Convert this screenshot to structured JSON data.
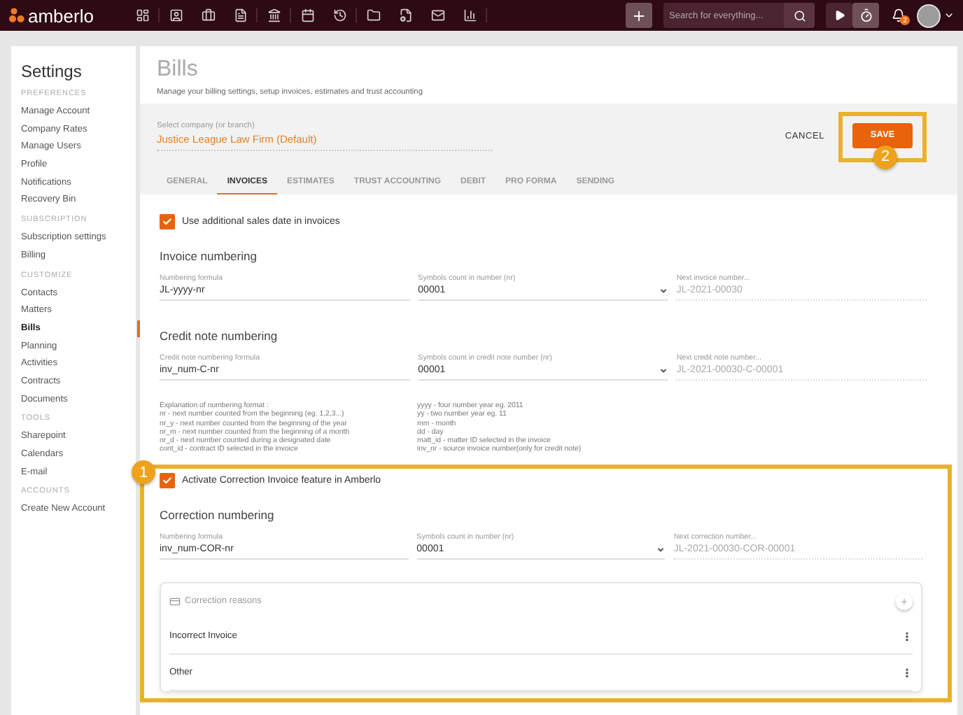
{
  "topbar": {
    "logo": "amberlo",
    "search": {
      "placeholder": "Search for everything..."
    },
    "notification_count": "2"
  },
  "sidebar": {
    "title": "Settings",
    "sections": [
      {
        "heading": "PREFERENCES",
        "items": [
          {
            "label": "Manage Account",
            "selected": false
          },
          {
            "label": "Company Rates",
            "selected": false
          },
          {
            "label": "Manage Users",
            "selected": false
          },
          {
            "label": "Profile",
            "selected": false
          },
          {
            "label": "Notifications",
            "selected": false
          },
          {
            "label": "Recovery Bin",
            "selected": false
          }
        ]
      },
      {
        "heading": "SUBSCRIPTION",
        "items": [
          {
            "label": "Subscription settings",
            "selected": false
          },
          {
            "label": "Billing",
            "selected": false
          }
        ]
      },
      {
        "heading": "CUSTOMIZE",
        "items": [
          {
            "label": "Contacts",
            "selected": false
          },
          {
            "label": "Matters",
            "selected": false
          },
          {
            "label": "Bills",
            "selected": true
          },
          {
            "label": "Planning",
            "selected": false
          },
          {
            "label": "Activities",
            "selected": false
          },
          {
            "label": "Contracts",
            "selected": false
          },
          {
            "label": "Documents",
            "selected": false
          }
        ]
      },
      {
        "heading": "TOOLS",
        "items": [
          {
            "label": "Sharepoint",
            "selected": false
          },
          {
            "label": "Calendars",
            "selected": false
          },
          {
            "label": "E-mail",
            "selected": false
          }
        ]
      },
      {
        "heading": "ACCOUNTS",
        "items": [
          {
            "label": "Create New Account",
            "selected": false
          }
        ]
      }
    ]
  },
  "page": {
    "title": "Bills",
    "subtitle": "Manage your billing settings, setup invoices, estimates and trust accounting",
    "company": {
      "label": "Select company (or branch)",
      "value": "Justice League Law Firm (Default)"
    },
    "buttons": {
      "cancel": "CANCEL",
      "save": "SAVE"
    },
    "tabs": [
      {
        "label": "GENERAL",
        "selected": false
      },
      {
        "label": "INVOICES",
        "selected": true
      },
      {
        "label": "ESTIMATES",
        "selected": false
      },
      {
        "label": "TRUST ACCOUNTING",
        "selected": false
      },
      {
        "label": "DEBIT",
        "selected": false
      },
      {
        "label": "PRO FORMA",
        "selected": false
      },
      {
        "label": "SENDING",
        "selected": false
      }
    ]
  },
  "sales_date": {
    "label": "Use additional sales date in invoices",
    "checked": true
  },
  "invoice_numbering": {
    "title": "Invoice numbering",
    "fields": [
      {
        "kind": "text",
        "label": "Numbering formula",
        "value": "JL-yyyy-nr"
      },
      {
        "kind": "select",
        "label": "Symbols count in number (nr)",
        "value": "00001"
      },
      {
        "kind": "readonly",
        "label": "Next invoice number...",
        "value": "JL-2021-00030"
      }
    ]
  },
  "credit_note_numbering": {
    "title": "Credit note numbering",
    "fields": [
      {
        "kind": "text",
        "label": "Credit note numbering formula",
        "value": "inv_num-C-nr"
      },
      {
        "kind": "select",
        "label": "Symbols count in credit note number (nr)",
        "value": "00001"
      },
      {
        "kind": "readonly",
        "label": "Next credit note number...",
        "value": "JL-2021-00030-C-00001"
      }
    ]
  },
  "explanation": {
    "left": [
      "Explanation of numbering format :",
      "nr - next number counted from the beginning (eg. 1,2,3...)",
      "nr_y - next number counted from the beginning of the year",
      "nr_m - next number counted from the beginning of a month",
      "nr_d - next number counted during a designated date",
      "cont_id - contract ID selected in the invoice"
    ],
    "right": [
      "yyyy - four number year eg. 2011",
      "yy - two number year eg. 11",
      "mm - month",
      "dd - day",
      "matt_id - matter ID selected in the invoice",
      "inv_nr - source invoice number(only for credit note)"
    ]
  },
  "correction": {
    "checkbox": {
      "label": "Activate Correction Invoice feature in Amberlo",
      "checked": true
    },
    "title": "Correction numbering",
    "fields": [
      {
        "kind": "text",
        "label": "Numbering formula",
        "value": "inv_num-COR-nr"
      },
      {
        "kind": "select",
        "label": "Symbols count in number (nr)",
        "value": "00001"
      },
      {
        "kind": "readonly",
        "label": "Next correction number...",
        "value": "JL-2021-00030-COR-00001"
      }
    ],
    "reasons": {
      "title": "Correction reasons",
      "items": [
        "Incorrect Invoice",
        "Other"
      ]
    }
  },
  "annotations": {
    "correction": {
      "number": "1"
    },
    "save": {
      "number": "2"
    }
  }
}
